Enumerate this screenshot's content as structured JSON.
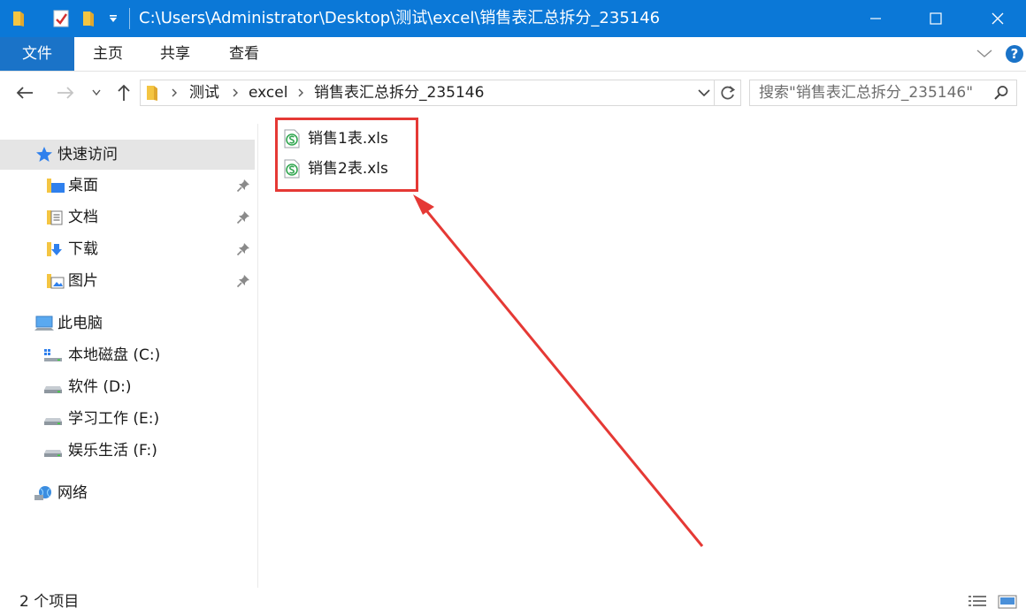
{
  "window": {
    "title": "C:\\Users\\Administrator\\Desktop\\测试\\excel\\销售表汇总拆分_235146",
    "minimize_glyph": "—",
    "maximize_glyph": "☐",
    "close_glyph": "✕"
  },
  "ribbon": {
    "tabs": [
      {
        "label": "文件"
      },
      {
        "label": "主页"
      },
      {
        "label": "共享"
      },
      {
        "label": "查看"
      }
    ],
    "help_glyph": "?"
  },
  "address": {
    "crumbs": [
      "测试",
      "excel",
      "销售表汇总拆分_235146"
    ]
  },
  "search": {
    "placeholder": "搜索\"销售表汇总拆分_235146\""
  },
  "sidebar": {
    "quick_access": "快速访问",
    "pinned": [
      {
        "label": "桌面"
      },
      {
        "label": "文档"
      },
      {
        "label": "下载"
      },
      {
        "label": "图片"
      }
    ],
    "this_pc": "此电脑",
    "drives": [
      {
        "label": "本地磁盘 (C:)"
      },
      {
        "label": "软件 (D:)"
      },
      {
        "label": "学习工作 (E:)"
      },
      {
        "label": "娱乐生活 (F:)"
      }
    ],
    "network": "网络"
  },
  "files": [
    {
      "name": "销售1表.xls",
      "icon": "spreadsheet-icon"
    },
    {
      "name": "销售2表.xls",
      "icon": "spreadsheet-icon"
    }
  ],
  "status": {
    "item_count": "2 个项目"
  },
  "colors": {
    "titlebar": "#0b78d7",
    "file_tab": "#1a73c8",
    "highlight": "#e53935",
    "selected": "#e5e5e5"
  }
}
